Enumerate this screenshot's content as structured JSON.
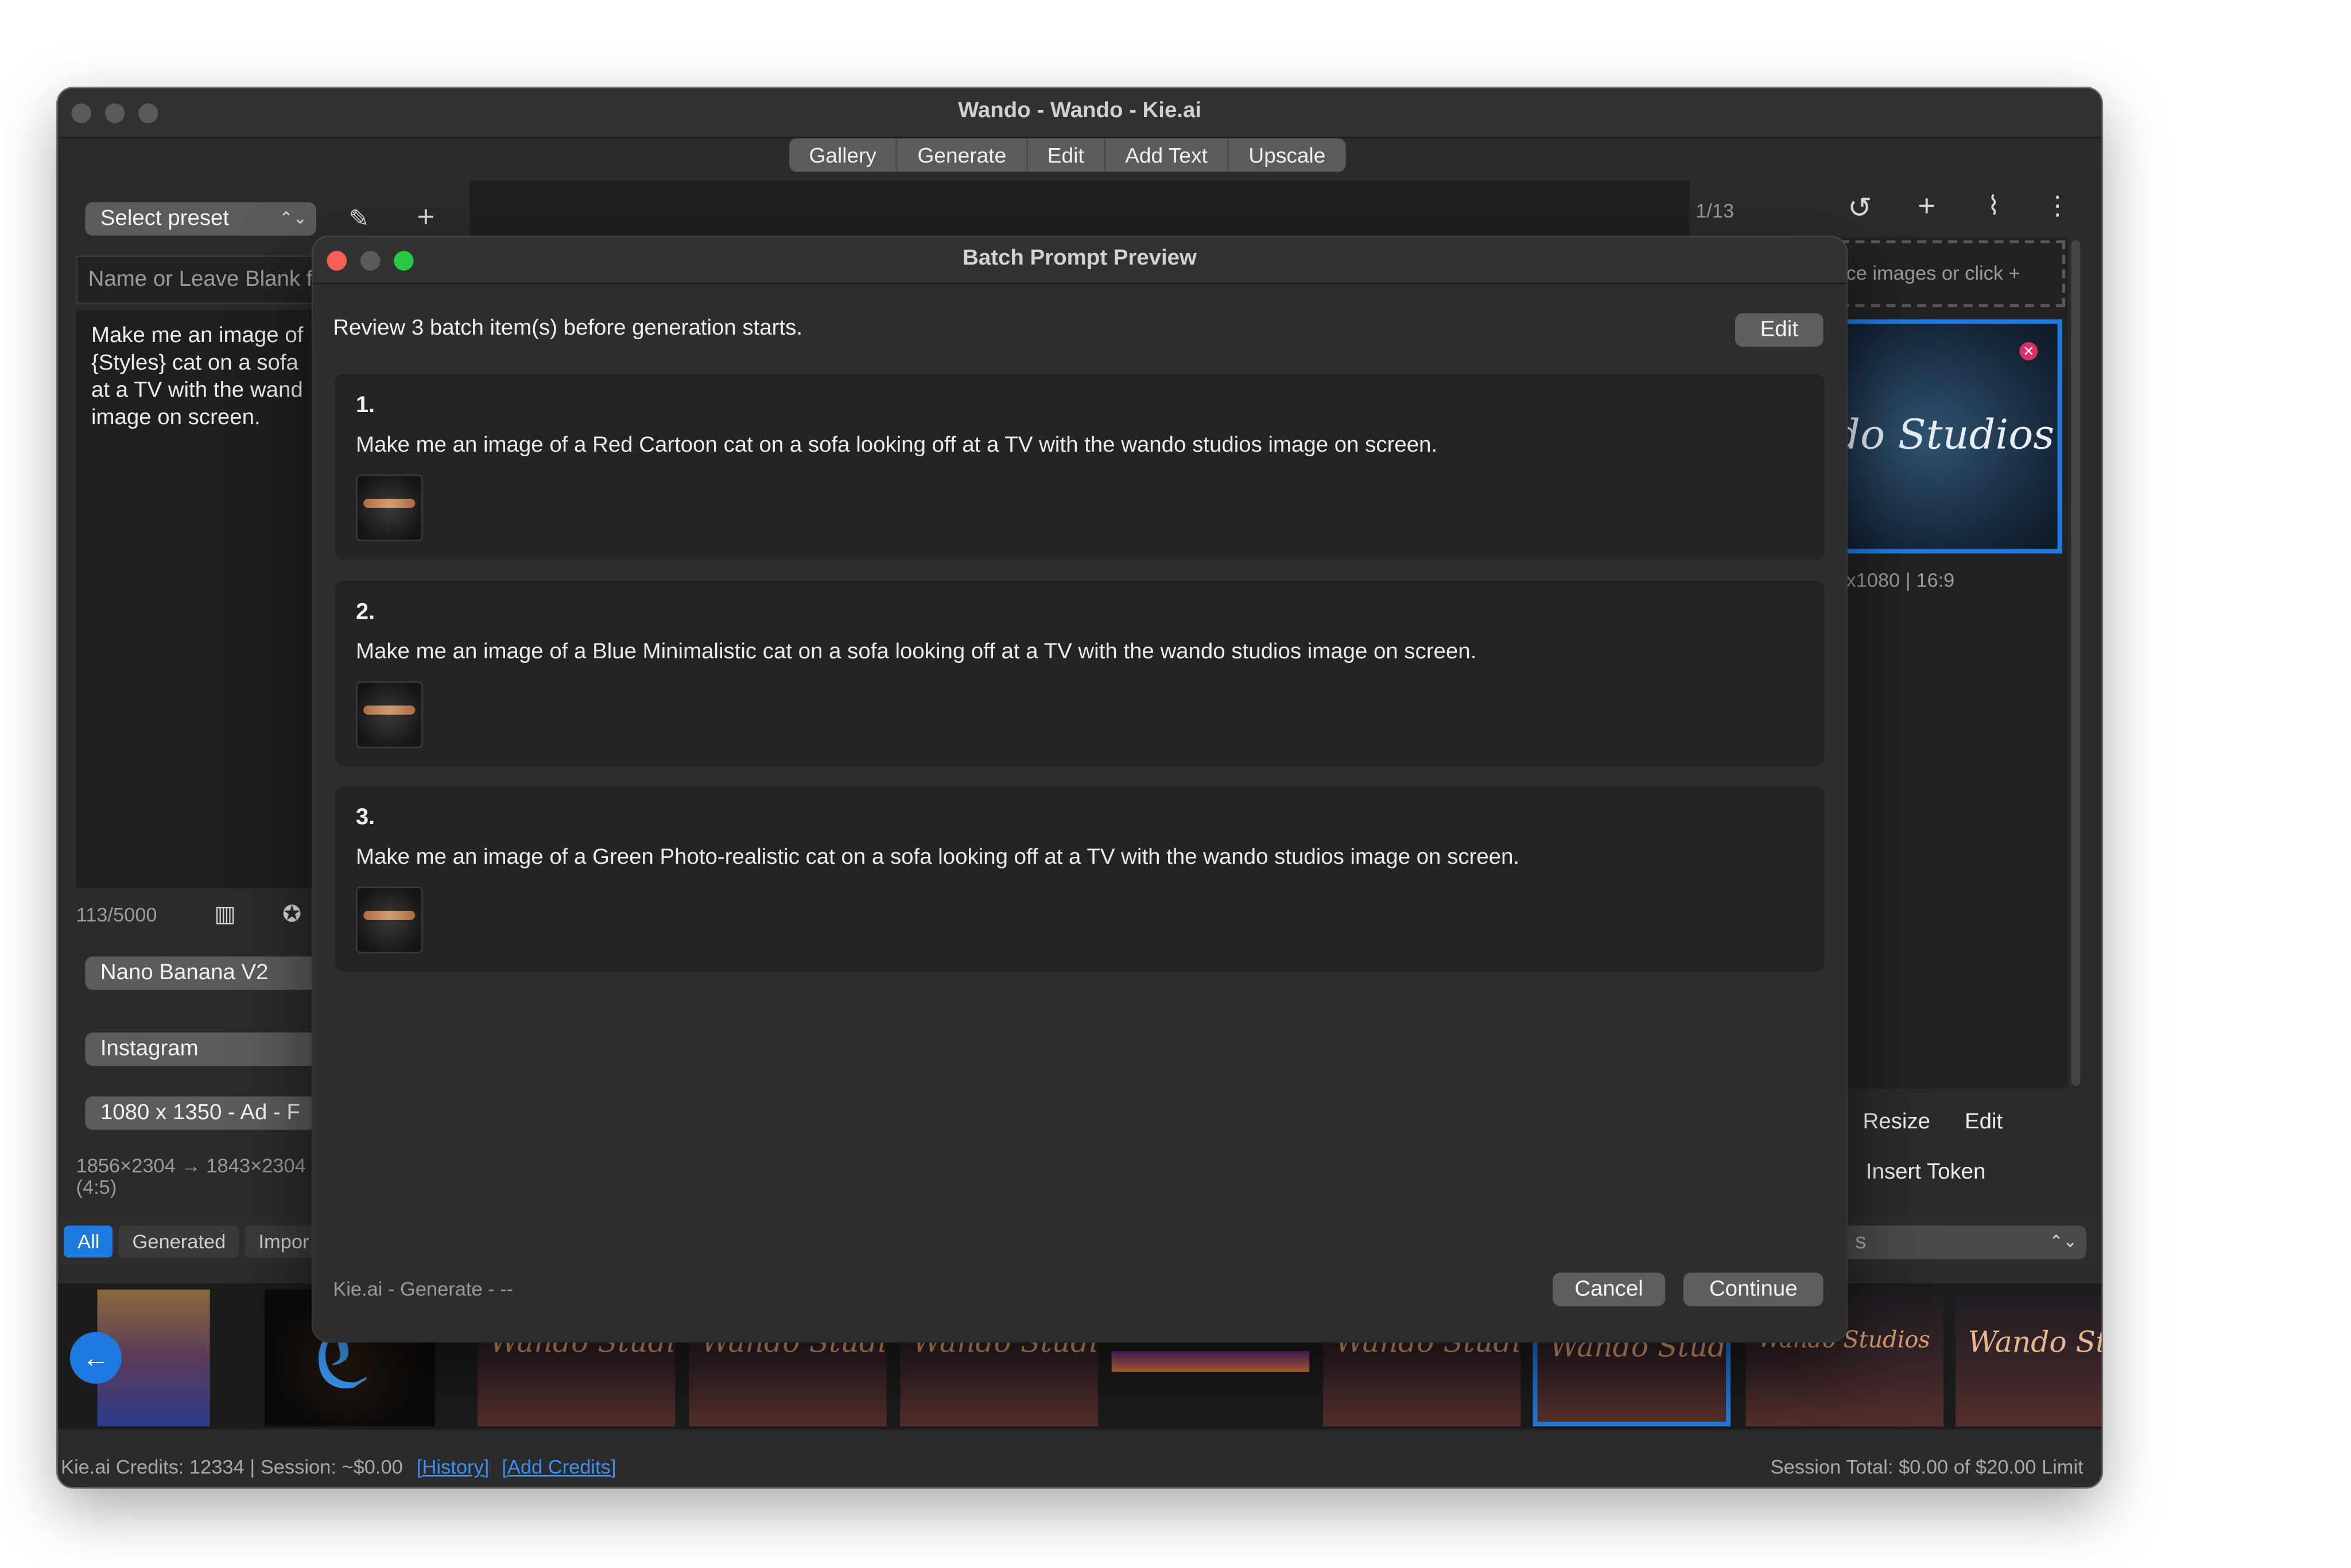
{
  "window": {
    "title": "Wando - Wando - Kie.ai"
  },
  "tabs": [
    "Gallery",
    "Generate",
    "Edit",
    "Add Text",
    "Upscale"
  ],
  "left": {
    "preset_label": "Select preset",
    "name_placeholder": "Name or Leave Blank f",
    "prompt_text": "Make me an image of {Styles} cat on a sofa at a TV with the wand image on screen.",
    "char_count": "113/5000",
    "model": "Nano Banana V2",
    "platform": "Instagram",
    "size": "1080 x 1350 - Ad - F",
    "dims_line1": "1856×2304 → 1843×2304",
    "dims_line2": "(4:5)"
  },
  "right": {
    "counter": "1/13",
    "drop_hint": "ce images or click +",
    "thumb_text": "do Studios",
    "thumb_meta": "x1080 | 16:9",
    "resize": "Resize",
    "edit": "Edit",
    "insert_token": "Insert Token",
    "select_tail": "s"
  },
  "filters": [
    "All",
    "Generated",
    "Impor"
  ],
  "strip": {
    "labels": [
      "Wando Studios",
      "Wando Studios",
      "Wando Studios",
      "",
      "Wando Studios",
      "Wando Studios",
      "Wando Studios",
      "Wando Stu"
    ]
  },
  "status": {
    "credits": "Kie.ai Credits: 12334 | Session: ~$0.00",
    "history": "[History]",
    "add_credits": "[Add Credits]",
    "session_total": "Session Total: $0.00 of $20.00 Limit"
  },
  "modal": {
    "title": "Batch Prompt Preview",
    "review_text": "Review 3 batch item(s) before generation starts.",
    "edit_label": "Edit",
    "items": [
      {
        "number": "1.",
        "text": "Make me an image of a Red Cartoon cat on a sofa looking off at a TV with the wando studios image on screen."
      },
      {
        "number": "2.",
        "text": "Make me an image of a Blue Minimalistic cat on a sofa looking off at a TV with the wando studios image on screen."
      },
      {
        "number": "3.",
        "text": "Make me an image of a Green Photo-realistic cat on a sofa looking off at a TV with the wando studios image on screen."
      }
    ],
    "footer_text": "Kie.ai - Generate - --",
    "cancel_label": "Cancel",
    "continue_label": "Continue"
  },
  "colors": {
    "accent": "#1f7ae0",
    "close": "#fe5f57",
    "minimize": "#febc2e",
    "zoom": "#28c840"
  }
}
